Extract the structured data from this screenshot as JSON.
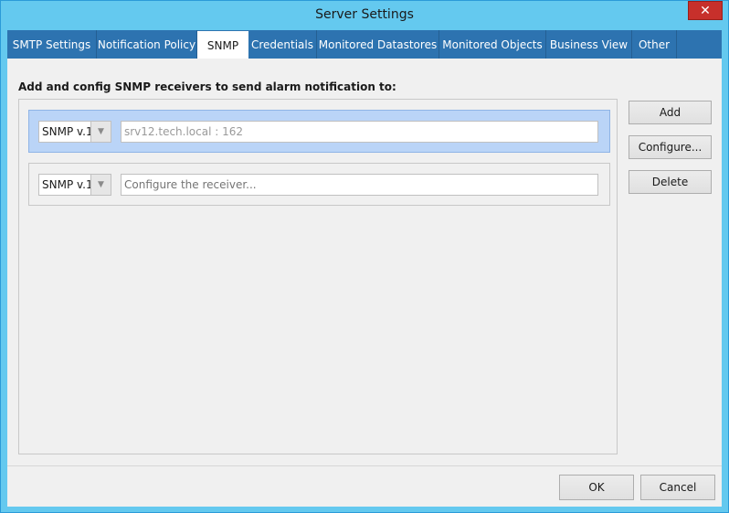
{
  "window": {
    "title": "Server Settings",
    "close_glyph": "✕"
  },
  "tabs": [
    {
      "label": "SMTP Settings"
    },
    {
      "label": "Notification Policy"
    },
    {
      "label": "SNMP"
    },
    {
      "label": "Credentials"
    },
    {
      "label": "Monitored Datastores"
    },
    {
      "label": "Monitored Objects"
    },
    {
      "label": "Business View"
    },
    {
      "label": "Other"
    }
  ],
  "active_tab": "SNMP",
  "snmp": {
    "heading": "Add and config SNMP receivers to send alarm notification to:",
    "receivers": [
      {
        "version": "SNMP v.1",
        "address": "srv12.tech.local : 162",
        "placeholder": ""
      },
      {
        "version": "SNMP v.1",
        "address": "",
        "placeholder": "Configure the receiver..."
      }
    ],
    "buttons": {
      "add": "Add",
      "configure": "Configure...",
      "delete": "Delete"
    }
  },
  "footer": {
    "ok": "OK",
    "cancel": "Cancel"
  },
  "icons": {
    "dropdown": "chevron-down-icon",
    "close": "close-icon"
  },
  "colors": {
    "titlebar": "#64c9ef",
    "tabbar": "#2d73b0",
    "selected_row": "#bad4f7",
    "close": "#c7302b"
  }
}
